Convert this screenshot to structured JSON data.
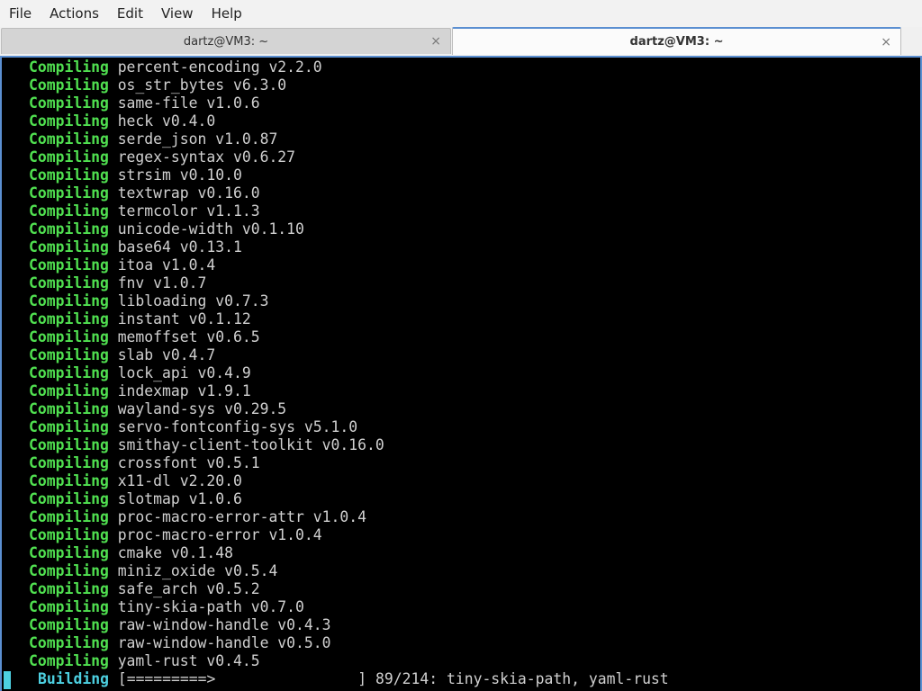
{
  "menubar": {
    "items": [
      "File",
      "Actions",
      "Edit",
      "View",
      "Help"
    ]
  },
  "tabs": [
    {
      "title": "dartz@VM3: ~",
      "close": "×",
      "active": false
    },
    {
      "title": "dartz@VM3: ~",
      "close": "×",
      "active": true
    }
  ],
  "terminal": {
    "lines": [
      {
        "verb": "Compiling",
        "crate": "percent-encoding v2.2.0"
      },
      {
        "verb": "Compiling",
        "crate": "os_str_bytes v6.3.0"
      },
      {
        "verb": "Compiling",
        "crate": "same-file v1.0.6"
      },
      {
        "verb": "Compiling",
        "crate": "heck v0.4.0"
      },
      {
        "verb": "Compiling",
        "crate": "serde_json v1.0.87"
      },
      {
        "verb": "Compiling",
        "crate": "regex-syntax v0.6.27"
      },
      {
        "verb": "Compiling",
        "crate": "strsim v0.10.0"
      },
      {
        "verb": "Compiling",
        "crate": "textwrap v0.16.0"
      },
      {
        "verb": "Compiling",
        "crate": "termcolor v1.1.3"
      },
      {
        "verb": "Compiling",
        "crate": "unicode-width v0.1.10"
      },
      {
        "verb": "Compiling",
        "crate": "base64 v0.13.1"
      },
      {
        "verb": "Compiling",
        "crate": "itoa v1.0.4"
      },
      {
        "verb": "Compiling",
        "crate": "fnv v1.0.7"
      },
      {
        "verb": "Compiling",
        "crate": "libloading v0.7.3"
      },
      {
        "verb": "Compiling",
        "crate": "instant v0.1.12"
      },
      {
        "verb": "Compiling",
        "crate": "memoffset v0.6.5"
      },
      {
        "verb": "Compiling",
        "crate": "slab v0.4.7"
      },
      {
        "verb": "Compiling",
        "crate": "lock_api v0.4.9"
      },
      {
        "verb": "Compiling",
        "crate": "indexmap v1.9.1"
      },
      {
        "verb": "Compiling",
        "crate": "wayland-sys v0.29.5"
      },
      {
        "verb": "Compiling",
        "crate": "servo-fontconfig-sys v5.1.0"
      },
      {
        "verb": "Compiling",
        "crate": "smithay-client-toolkit v0.16.0"
      },
      {
        "verb": "Compiling",
        "crate": "crossfont v0.5.1"
      },
      {
        "verb": "Compiling",
        "crate": "x11-dl v2.20.0"
      },
      {
        "verb": "Compiling",
        "crate": "slotmap v1.0.6"
      },
      {
        "verb": "Compiling",
        "crate": "proc-macro-error-attr v1.0.4"
      },
      {
        "verb": "Compiling",
        "crate": "proc-macro-error v1.0.4"
      },
      {
        "verb": "Compiling",
        "crate": "cmake v0.1.48"
      },
      {
        "verb": "Compiling",
        "crate": "miniz_oxide v0.5.4"
      },
      {
        "verb": "Compiling",
        "crate": "safe_arch v0.5.2"
      },
      {
        "verb": "Compiling",
        "crate": "tiny-skia-path v0.7.0"
      },
      {
        "verb": "Compiling",
        "crate": "raw-window-handle v0.4.3"
      },
      {
        "verb": "Compiling",
        "crate": "raw-window-handle v0.5.0"
      },
      {
        "verb": "Compiling",
        "crate": "yaml-rust v0.4.5"
      }
    ],
    "status": {
      "verb": "Building",
      "progress_bar": "[=========>                ]",
      "counter": "89/214",
      "current": ": tiny-skia-path, yaml-rust"
    }
  },
  "colors": {
    "verb_green": "#50e050",
    "building_cyan": "#4dd0e1",
    "tab_accent": "#5b8fd1",
    "terminal_bg": "#000000"
  }
}
